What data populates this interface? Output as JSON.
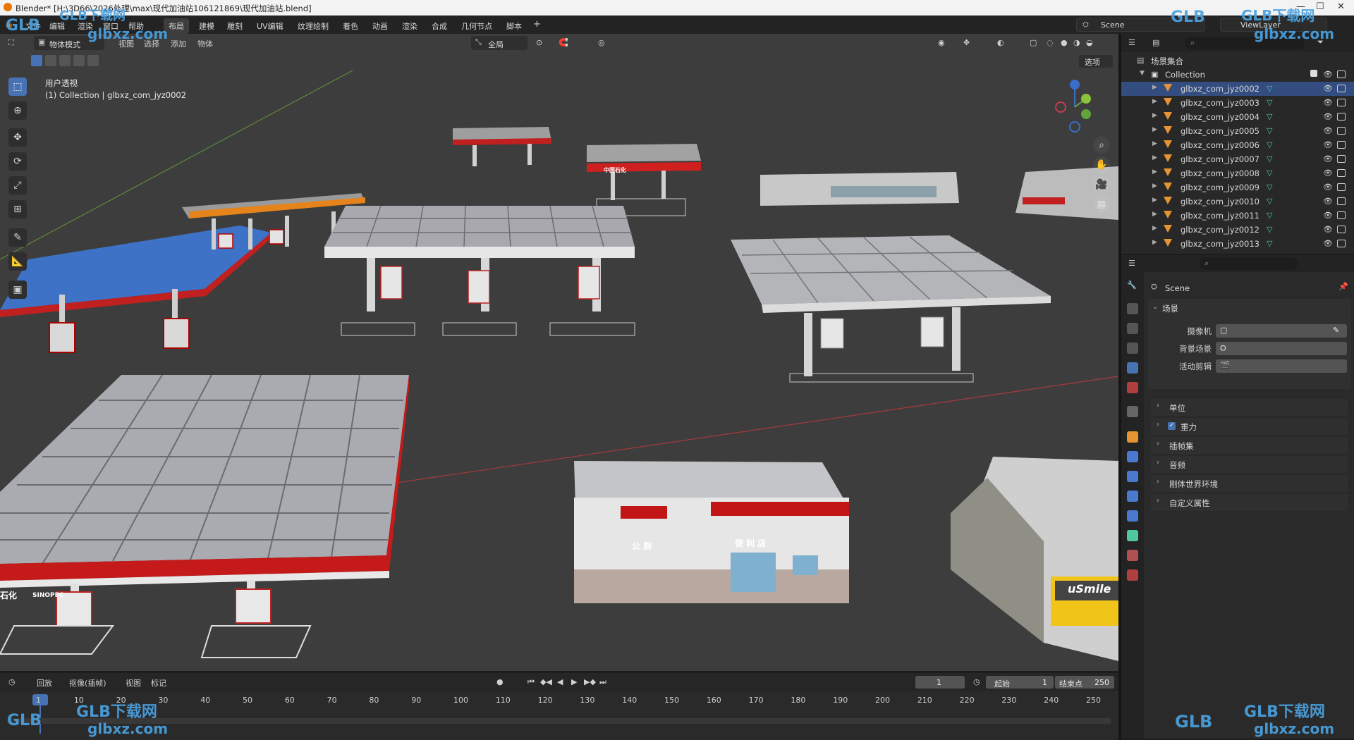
{
  "window": {
    "title": "Blender* [H:\\3D66\\2026处理\\max\\现代加油站106121869\\现代加油站.blend]"
  },
  "menubar": {
    "menus": [
      "文件",
      "编辑",
      "渲染",
      "窗口",
      "帮助"
    ],
    "workspaces": [
      "布局",
      "建模",
      "雕刻",
      "UV编辑",
      "纹理绘制",
      "着色",
      "动画",
      "渲染",
      "合成",
      "几何节点",
      "脚本"
    ],
    "active_workspace": "布局",
    "add_tab": "+",
    "scene_name": "Scene",
    "view_layer": "ViewLayer"
  },
  "viewport_header": {
    "mode": "物体模式",
    "menus": [
      "视图",
      "选择",
      "添加",
      "物体"
    ],
    "transform_orientation": "全局",
    "options_label": "选项"
  },
  "viewport": {
    "view_name": "用户透视",
    "collection_info": "(1) Collection | glbxz_com_jyz0002"
  },
  "tools": [
    "select-box",
    "cursor",
    "move",
    "rotate",
    "scale",
    "transform",
    "annotate",
    "measure",
    "add-cube"
  ],
  "scene_labels": {
    "sign_toilet": "公 厕",
    "sign_store": "便 利 店",
    "sign_usmile": "uSmile",
    "sign_sinopec": "SINOPEC",
    "sign_sinopec_cn": "中国石化",
    "sign_fragment": "石化"
  },
  "outliner": {
    "root": "场景集合",
    "collection": "Collection",
    "objects": [
      "glbxz_com_jyz0002",
      "glbxz_com_jyz0003",
      "glbxz_com_jyz0004",
      "glbxz_com_jyz0005",
      "glbxz_com_jyz0006",
      "glbxz_com_jyz0007",
      "glbxz_com_jyz0008",
      "glbxz_com_jyz0009",
      "glbxz_com_jyz0010",
      "glbxz_com_jyz0011",
      "glbxz_com_jyz0012",
      "glbxz_com_jyz0013"
    ],
    "selected_index": 0
  },
  "properties": {
    "context_name": "Scene",
    "section_scene": "场景",
    "camera_label": "摄像机",
    "background_label": "背景场景",
    "clip_label": "活动剪辑",
    "panels": [
      "单位",
      "重力",
      "插帧集",
      "音频",
      "刚体世界环境",
      "自定义属性"
    ],
    "gravity_checked": true
  },
  "timeline": {
    "menus": [
      "回放",
      "抠像(插帧)",
      "视图",
      "标记"
    ],
    "current_frame": "1",
    "start_label": "起始",
    "start_value": "1",
    "end_label": "结束点",
    "end_value": "250",
    "ruler_ticks": [
      "1",
      "10",
      "20",
      "30",
      "40",
      "50",
      "60",
      "70",
      "80",
      "90",
      "100",
      "110",
      "120",
      "130",
      "140",
      "150",
      "160",
      "170",
      "180",
      "190",
      "200",
      "210",
      "220",
      "230",
      "240",
      "250"
    ]
  },
  "watermarks": {
    "brand": "GLB下载网",
    "url": "glbxz.com",
    "logo": "GLB"
  },
  "colors": {
    "accent_blue": "#4772b3",
    "selection": "#334d80",
    "mesh_orange": "#e69433",
    "canopy_red": "#c41a1a",
    "watermark_blue": "#4aa1e0"
  }
}
